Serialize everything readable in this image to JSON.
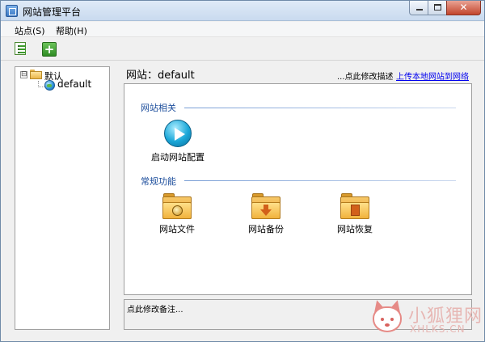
{
  "window": {
    "title": "网站管理平台",
    "controls": {
      "minimize_glyph": "—",
      "maximize_glyph": "□",
      "close_glyph": "✕"
    }
  },
  "menu": [
    {
      "label": "站点(S)"
    },
    {
      "label": "帮助(H)"
    }
  ],
  "toolbar": {
    "buttons": [
      {
        "icon": "site-list-icon"
      },
      {
        "icon": "add-icon",
        "glyph": "+"
      }
    ]
  },
  "tree": {
    "root": {
      "label": "默认",
      "expander": "⊟"
    },
    "children": [
      {
        "label": "default"
      }
    ]
  },
  "header": {
    "site_title": "网站：default",
    "edit_desc": "...点此修改描述",
    "upload_link": "上传本地网站到网络"
  },
  "sections": [
    {
      "title": "网站相关",
      "actions": [
        {
          "label": "启动网站配置",
          "icon": "play-icon"
        }
      ]
    },
    {
      "title": "常规功能",
      "actions": [
        {
          "label": "网站文件",
          "icon": "folder-files-icon"
        },
        {
          "label": "网站备份",
          "icon": "folder-backup-icon"
        },
        {
          "label": "网站恢复",
          "icon": "folder-restore-icon"
        }
      ]
    }
  ],
  "note": {
    "text": "点此修改备注..."
  },
  "watermark": {
    "text": "小狐狸网",
    "sub": "XHLKS.CN"
  },
  "colors": {
    "accent": "#1d4e9c",
    "link": "#0000ee",
    "close": "#c2452c"
  }
}
